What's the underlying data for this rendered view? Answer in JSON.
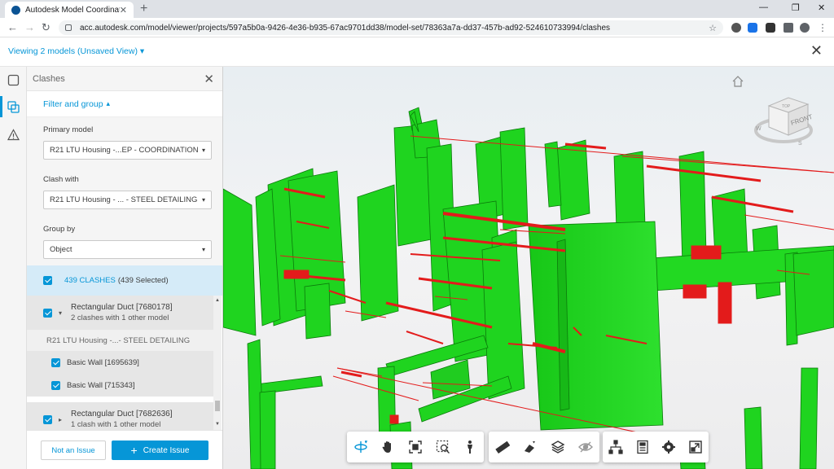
{
  "browser": {
    "tab_title": "Autodesk Model Coordination",
    "tab_close": "✕",
    "new_tab": "+",
    "window_controls": [
      "—",
      "❐",
      "✕"
    ],
    "url": "acc.autodesk.com/model/viewer/projects/597a5b0a-9426-4e36-b935-67ac9701dd38/model-set/78363a7a-dd37-457b-ad92-524610733994/clashes",
    "nav": [
      "←",
      "→",
      "↻"
    ],
    "star": "☆"
  },
  "app": {
    "viewing_label": "Viewing 2 models (Unsaved View)",
    "viewing_caret": "▾",
    "close": "✕"
  },
  "panel": {
    "title": "Clashes",
    "close": "✕",
    "filter_toggle": "Filter and group",
    "filter_toggle_caret": "▴",
    "primary_model_label": "Primary model",
    "primary_model_value": "R21 LTU Housing -...EP - COORDINATION",
    "clash_with_label": "Clash with",
    "clash_with_value": "R21 LTU Housing - ... - STEEL DETAILING",
    "group_by_label": "Group by",
    "group_by_value": "Object",
    "select_caret": "▾",
    "summary_count": "439 CLASHES",
    "summary_selected": "(439 Selected)",
    "groups": [
      {
        "title": "Rectangular Duct [7680178]",
        "subtitle": "2 clashes with 1 other model",
        "expanded": true,
        "model": "R21 LTU Housing -...- STEEL DETAILING",
        "items": [
          "Basic Wall [1695639]",
          "Basic Wall [715343]"
        ]
      },
      {
        "title": "Rectangular Duct [7682636]",
        "subtitle": "1 clash with 1 other model",
        "expanded": false
      }
    ],
    "expanded_caret": "▾",
    "collapsed_caret": "▸",
    "scroll_up": "▲",
    "scroll_down": "▼",
    "not_an_issue": "Not an Issue",
    "create_issue": "Create Issue",
    "create_plus": "+"
  },
  "viewcube": {
    "front_label": "FRONT",
    "top_label": "TOP",
    "compass": [
      "W",
      "S"
    ]
  },
  "colors": {
    "accent": "#0696d7",
    "geometry_primary": "#1ed41e",
    "geometry_clash": "#e31b1b"
  }
}
